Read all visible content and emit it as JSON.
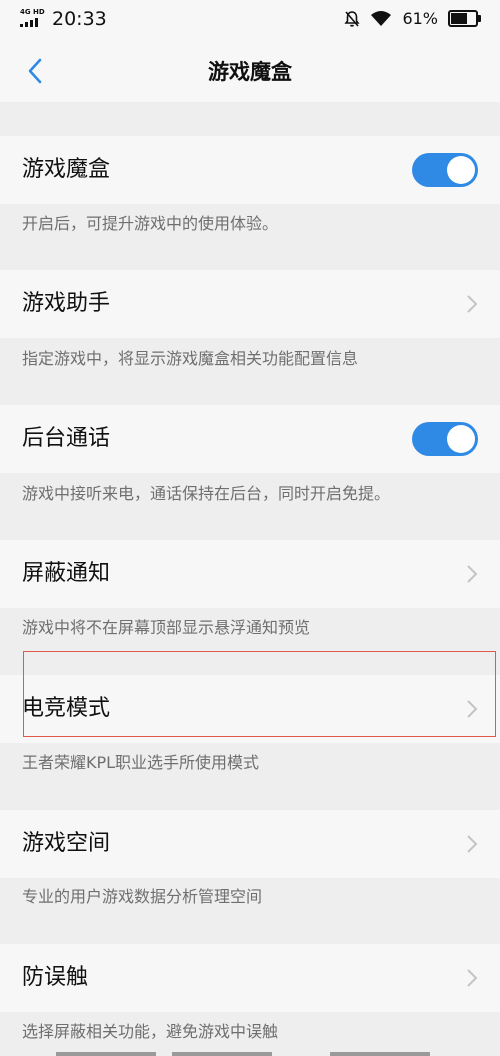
{
  "status_bar": {
    "network": "4G HD",
    "time": "20:33",
    "battery_percent": "61%",
    "battery_level": 0.61,
    "icons": [
      "mute-bell-icon",
      "wifi-icon",
      "battery-icon"
    ]
  },
  "header": {
    "back_icon": "chevron-left-icon",
    "title": "游戏魔盒"
  },
  "colors": {
    "accent": "#2f8ae6",
    "highlight_border": "#e05a4b",
    "background": "#eeeeee",
    "row_background": "#f7f7f7",
    "description_text": "#6f6f6f"
  },
  "settings": [
    {
      "label": "游戏魔盒",
      "description": "开启后，可提升游戏中的使用体验。",
      "control": "toggle",
      "enabled": true
    },
    {
      "label": "游戏助手",
      "description": "指定游戏中，将显示游戏魔盒相关功能配置信息",
      "control": "chevron"
    },
    {
      "label": "后台通话",
      "description": "游戏中接听来电，通话保持在后台，同时开启免提。",
      "control": "toggle",
      "enabled": true
    },
    {
      "label": "屏蔽通知",
      "description": "游戏中将不在屏幕顶部显示悬浮通知预览",
      "control": "chevron"
    },
    {
      "label": "电竞模式",
      "description": "王者荣耀KPL职业选手所使用模式",
      "control": "chevron",
      "highlighted": true
    },
    {
      "label": "游戏空间",
      "description": "专业的用户游戏数据分析管理空间",
      "control": "chevron"
    },
    {
      "label": "防误触",
      "description": "选择屏蔽相关功能，避免游戏中误触",
      "control": "chevron"
    }
  ]
}
